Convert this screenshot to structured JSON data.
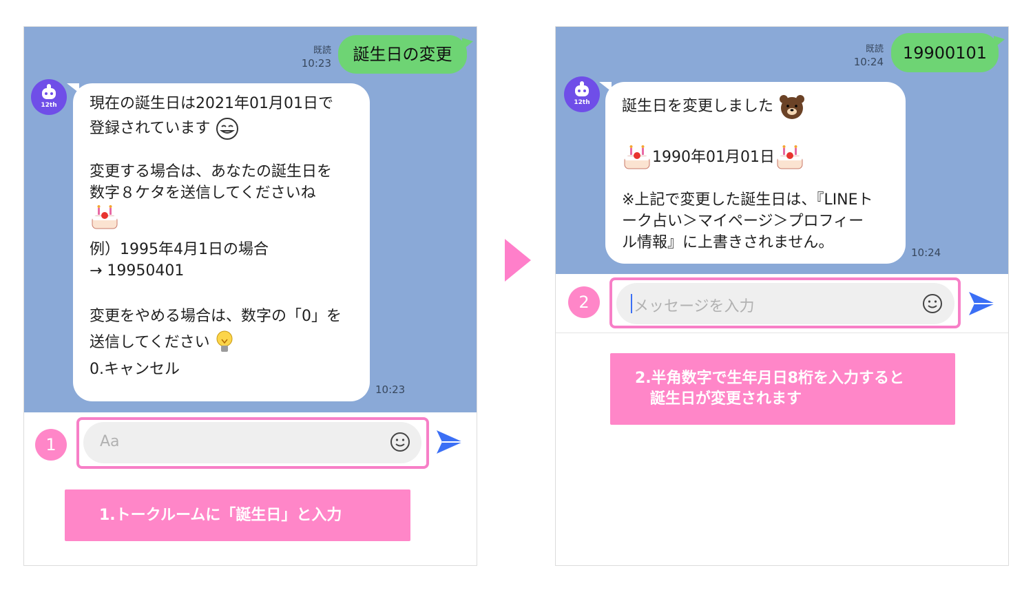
{
  "panel1": {
    "sent_message": "誕生日の変更",
    "sent_read": "既読",
    "sent_time": "10:23",
    "avatar_year": "12th",
    "bot_lines": [
      "現在の誕生日は2021年01月01日で",
      "登録されています",
      "",
      "変更する場合は、あなたの誕生日を",
      "数字８ケタを送信してくださいね",
      "",
      "",
      "例）1995年4月1日の場合",
      "→ 19950401",
      "",
      "変更をやめる場合は、数字の「0」を",
      "送信してください",
      "0.キャンセル"
    ],
    "bot_time": "10:23",
    "input_placeholder": "Aa",
    "step_number": "1",
    "caption": "1.トークルームに「誕生日」と入力"
  },
  "panel2": {
    "sent_message": "19900101",
    "sent_read": "既読",
    "sent_time": "10:24",
    "avatar_year": "12th",
    "bot_lines": [
      "誕生日を変更しました",
      "",
      "1990年01月01日",
      "",
      "※上記で変更した誕生日は、『LINEト",
      "ーク占い＞マイページ＞プロフィー",
      "ル情報』に上書きされません。"
    ],
    "bot_time": "10:24",
    "input_placeholder": "メッセージを入力",
    "step_number": "2",
    "caption_lines": [
      "2.半角数字で生年月日8桁を入力すると",
      "誕生日が変更されます"
    ]
  },
  "icons": [
    "bot-avatar-icon",
    "smile-icon",
    "send-icon",
    "cake-icon",
    "bear-icon",
    "lightbulb-icon",
    "emoji-face-icon",
    "next-arrow-icon"
  ],
  "colors": {
    "chat_bg": "#8aa9d7",
    "sent_bubble": "#6ed474",
    "highlight": "#f77fc7",
    "caption_bg": "#ff86c8",
    "avatar": "#6f4ee8",
    "send": "#3b6ff5"
  }
}
